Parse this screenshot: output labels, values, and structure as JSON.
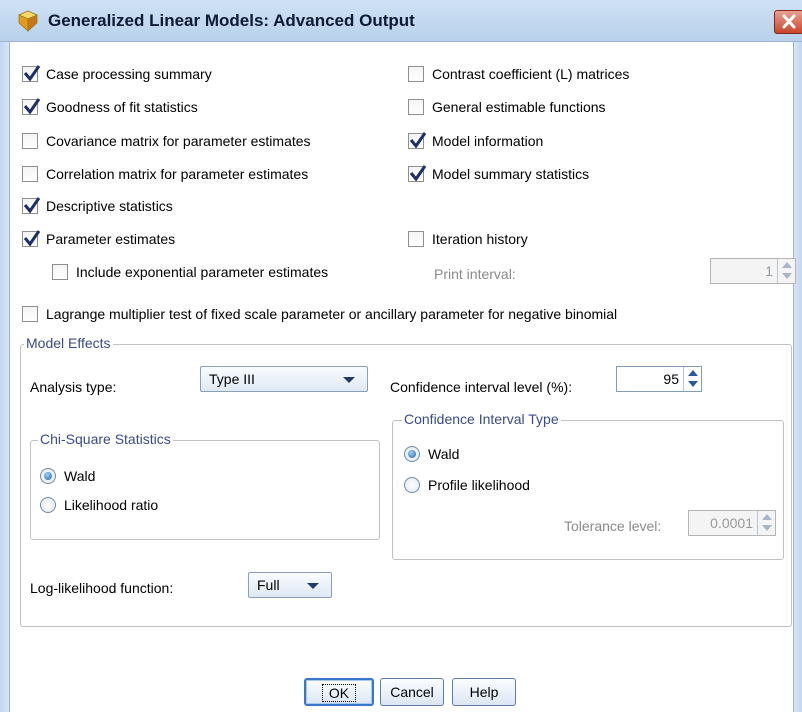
{
  "window": {
    "title": "Generalized Linear Models: Advanced Output"
  },
  "options": {
    "case_processing_summary": {
      "label": "Case processing summary",
      "checked": true
    },
    "goodness_of_fit": {
      "label": "Goodness of fit statistics",
      "checked": true
    },
    "covariance_matrix": {
      "label": "Covariance matrix for parameter estimates",
      "checked": false
    },
    "correlation_matrix": {
      "label": "Correlation matrix for parameter estimates",
      "checked": false
    },
    "descriptive_statistics": {
      "label": "Descriptive statistics",
      "checked": true
    },
    "parameter_estimates": {
      "label": "Parameter estimates",
      "checked": true
    },
    "include_exponential": {
      "label": "Include exponential parameter estimates",
      "checked": false
    },
    "contrast_coefficient": {
      "label": "Contrast coefficient (L) matrices",
      "checked": false
    },
    "general_estimable": {
      "label": "General estimable functions",
      "checked": false
    },
    "model_information": {
      "label": "Model information",
      "checked": true
    },
    "model_summary": {
      "label": "Model summary statistics",
      "checked": true
    },
    "iteration_history": {
      "label": "Iteration history",
      "checked": false
    },
    "lagrange": {
      "label": "Lagrange multiplier test of fixed scale parameter or ancillary parameter for negative binomial",
      "checked": false
    }
  },
  "print_interval": {
    "label": "Print interval:",
    "value": "1"
  },
  "model_effects": {
    "legend": "Model Effects",
    "analysis_type_label": "Analysis type:",
    "analysis_type_value": "Type III",
    "ci_level_label": "Confidence interval level (%):",
    "ci_level_value": "95",
    "chi_square": {
      "legend": "Chi-Square Statistics",
      "options": [
        {
          "label": "Wald",
          "selected": true
        },
        {
          "label": "Likelihood ratio",
          "selected": false
        }
      ]
    },
    "ci_type": {
      "legend": "Confidence Interval Type",
      "options": [
        {
          "label": "Wald",
          "selected": true
        },
        {
          "label": "Profile likelihood",
          "selected": false
        }
      ],
      "tolerance_label": "Tolerance level:",
      "tolerance_value": "0.0001"
    },
    "loglik_label": "Log-likelihood function:",
    "loglik_value": "Full"
  },
  "buttons": {
    "ok": "OK",
    "cancel": "Cancel",
    "help": "Help"
  }
}
